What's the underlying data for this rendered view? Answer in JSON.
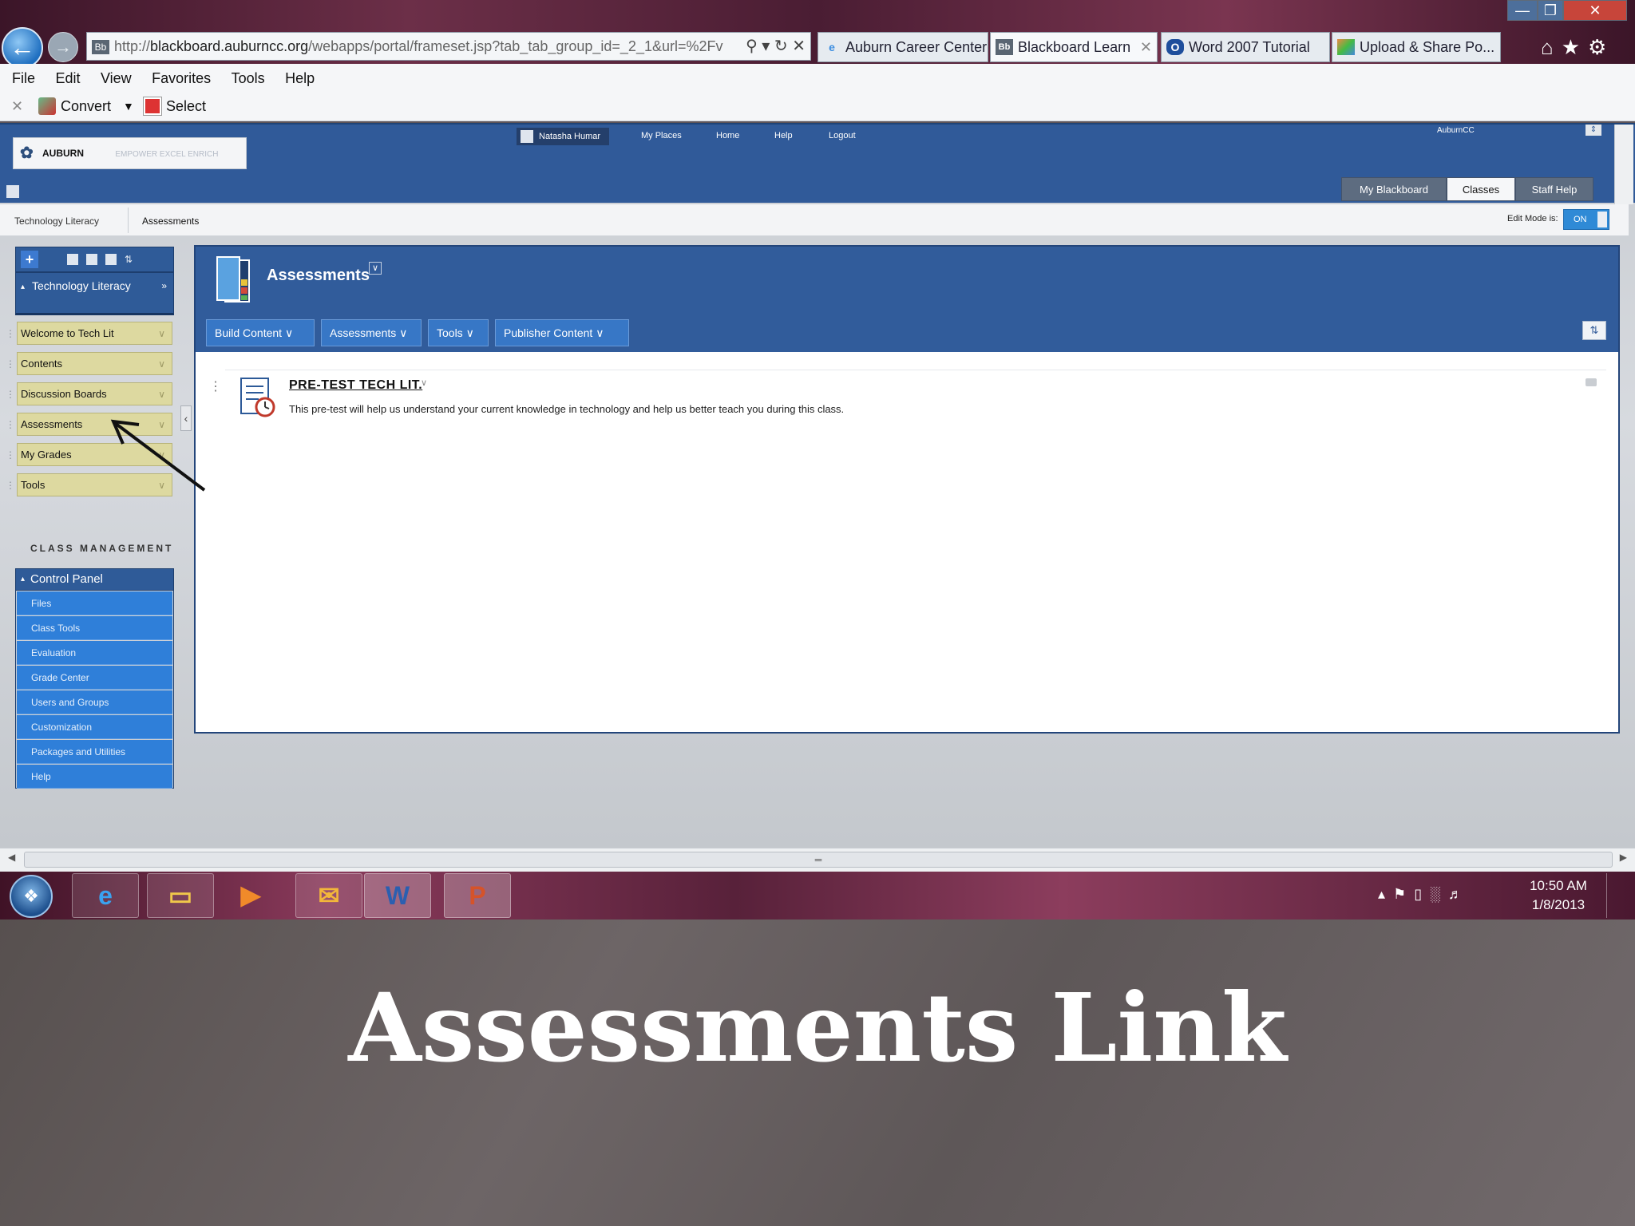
{
  "browser": {
    "url_prefix": "http://",
    "url_domain": "blackboard.auburncc.org",
    "url_path": "/webapps/portal/frameset.jsp?tab_tab_group_id=_2_1&url=%2Fv",
    "tabs": [
      {
        "label": "Auburn Career Center",
        "icon": "ie-icon"
      },
      {
        "label": "Blackboard Learn",
        "icon": "blackboard-icon",
        "close": "✕"
      },
      {
        "label": "Word 2007 Tutorial",
        "icon": "word-tutorial-icon"
      },
      {
        "label": "Upload & Share Po...",
        "icon": "upload-icon"
      }
    ],
    "menu": [
      "File",
      "Edit",
      "View",
      "Favorites",
      "Tools",
      "Help"
    ],
    "command_bar": {
      "convert": "Convert",
      "select": "Select"
    }
  },
  "bb": {
    "logo_text": "AUBURN",
    "logo_tagline": "EMPOWER EXCEL ENRICH",
    "user": "Natasha Humar",
    "top_nav": [
      "My Places",
      "Home",
      "Help",
      "Logout"
    ],
    "institution": "AuburnCC",
    "tabs": [
      "My Blackboard",
      "Classes",
      "Staff Help"
    ],
    "active_tab": "Classes",
    "breadcrumb": [
      "Technology Literacy",
      "Assessments"
    ],
    "edit_mode_label": "Edit Mode is:",
    "edit_mode_value": "ON"
  },
  "course_menu": {
    "title": "Technology Literacy",
    "items": [
      "Welcome to Tech Lit",
      "Contents",
      "Discussion Boards",
      "Assessments",
      "My Grades",
      "Tools"
    ],
    "class_management_label": "CLASS MANAGEMENT",
    "control_panel": "Control Panel",
    "control_panel_items": [
      "Files",
      "Class Tools",
      "Evaluation",
      "Grade Center",
      "Users and Groups",
      "Customization",
      "Packages and Utilities",
      "Help"
    ]
  },
  "content": {
    "title": "Assessments",
    "action_bar": [
      "Build Content",
      "Assessments",
      "Tools",
      "Publisher Content"
    ],
    "item_title": "PRE-TEST TECH LIT.",
    "item_description": "This pre-test will help us understand your current knowledge in technology and help us better teach you during this class."
  },
  "taskbar": {
    "time": "10:50 AM",
    "date": "1/8/2013"
  },
  "slide": {
    "caption": "Assessments Link"
  }
}
